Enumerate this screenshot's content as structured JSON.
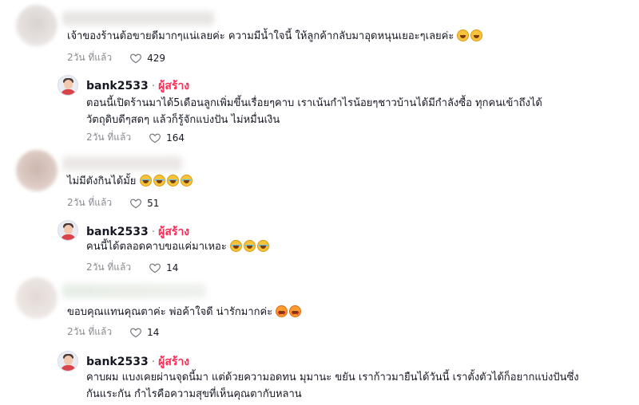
{
  "comments": [
    {
      "text": "เจ้าของร้านต้อขายดีมากๆแน่เลยค่ะ ความมีน้ำใจนี้ ให้ลูกค้ากลับมาอุดหนุนเยอะๆเลยค่ะ",
      "time": "2วัน ที่แล้ว",
      "likes": "429"
    },
    {
      "username": "bank2533",
      "separator": "·",
      "badge": "ผู้สร้าง",
      "lines": [
        "ตอนนี้เปิดร้านมาได้5เดือนลูกเพิ่มขึ้นเรื่อยๆคาบ เราเน้นกำไรน้อยๆชาวบ้านได้มีกำลังซื้อ ทุกคนเข้าถึงได้",
        "วัตถุดิบดีๆสดๆ แล้วก็รู้จักแบ่งปัน ไม่หมื่นเงิน"
      ],
      "time": "2วัน ที่แล้ว",
      "likes": "164"
    },
    {
      "text": "ไม่มีตังกินได้มั้ย",
      "time": "2วัน ที่แล้ว",
      "likes": "51"
    },
    {
      "username": "bank2533",
      "separator": "·",
      "badge": "ผู้สร้าง",
      "text": "คนนี้ได้ตลอดคาบขอแค่มาเหอะ",
      "time": "2วัน ที่แล้ว",
      "likes": "14"
    },
    {
      "text": "ขอบคุณแทนคุณตาค่ะ พ่อค้าใจดี น่ารักมากค่ะ",
      "time": "2วัน ที่แล้ว",
      "likes": "14"
    },
    {
      "username": "bank2533",
      "separator": "·",
      "badge": "ผู้สร้าง",
      "lines": [
        "คาบผม แบงเคยผ่านจุดนี้มา แต่ด้วยความอดทน มุมานะ ขยัน เราก้าวมายืนได้วันนี้ เราตั้งตัวได้ก็อยากแบ่งปันซึ่ง",
        "กันแระกัน กำไรคือความสุขที่เห็นคุณตากับหลาน"
      ]
    }
  ],
  "icons": {
    "like": "heart-outline-icon",
    "avatar_creator": "creator-avatar",
    "emoji_smile": "smiling-face-emoji",
    "emoji_laugh": "tears-of-joy-emoji",
    "emoji_love": "heart-eyes-emoji"
  },
  "colors": {
    "badge": "#fe2c55",
    "meta": "#8a8b91",
    "text": "#161823"
  }
}
